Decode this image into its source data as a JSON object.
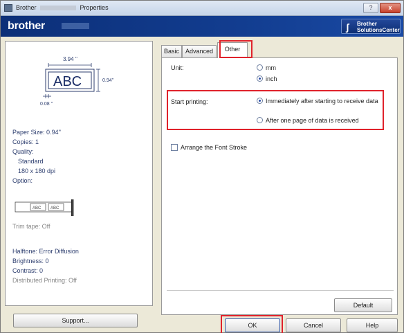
{
  "window": {
    "title_prefix": "Brother",
    "title_suffix": "Properties",
    "help_glyph": "?",
    "close_glyph": "x"
  },
  "brand": {
    "logo": "brother",
    "solutions_line1": "Brother",
    "solutions_line2": "SolutionsCenter"
  },
  "preview": {
    "width_label": "3.94 ''",
    "height_label": "0.94''",
    "margin_label": "0.08 ''",
    "sample_text": "ABC"
  },
  "summary": {
    "paper_size": "Paper Size: 0.94''",
    "copies": "Copies: 1",
    "quality_label": "Quality:",
    "quality_value": "Standard",
    "resolution": "180 x 180 dpi",
    "option_label": "Option:",
    "trim_tape": "Trim tape: Off",
    "halftone": "Halftone: Error Diffusion",
    "brightness": "Brightness:  0",
    "contrast": "Contrast:  0",
    "distributed": "Distributed Printing: Off",
    "tape_sample": "ABC"
  },
  "buttons": {
    "support": "Support...",
    "default": "Default",
    "ok": "OK",
    "cancel": "Cancel",
    "help": "Help"
  },
  "tabs": [
    {
      "label": "Basic"
    },
    {
      "label": "Advanced"
    },
    {
      "label": "Other"
    }
  ],
  "other_tab": {
    "unit_label": "Unit:",
    "unit_options": [
      {
        "label": "mm",
        "selected": false
      },
      {
        "label": "inch",
        "selected": true
      }
    ],
    "start_label": "Start printing:",
    "start_options": [
      {
        "label": "Immediately after starting to receive data",
        "selected": true
      },
      {
        "label": "After one page of data is received",
        "selected": false
      }
    ],
    "font_stroke_label": "Arrange the Font Stroke",
    "font_stroke_checked": false
  },
  "colors": {
    "brand_blue": "#123d90",
    "highlight_red": "#e0222b"
  }
}
